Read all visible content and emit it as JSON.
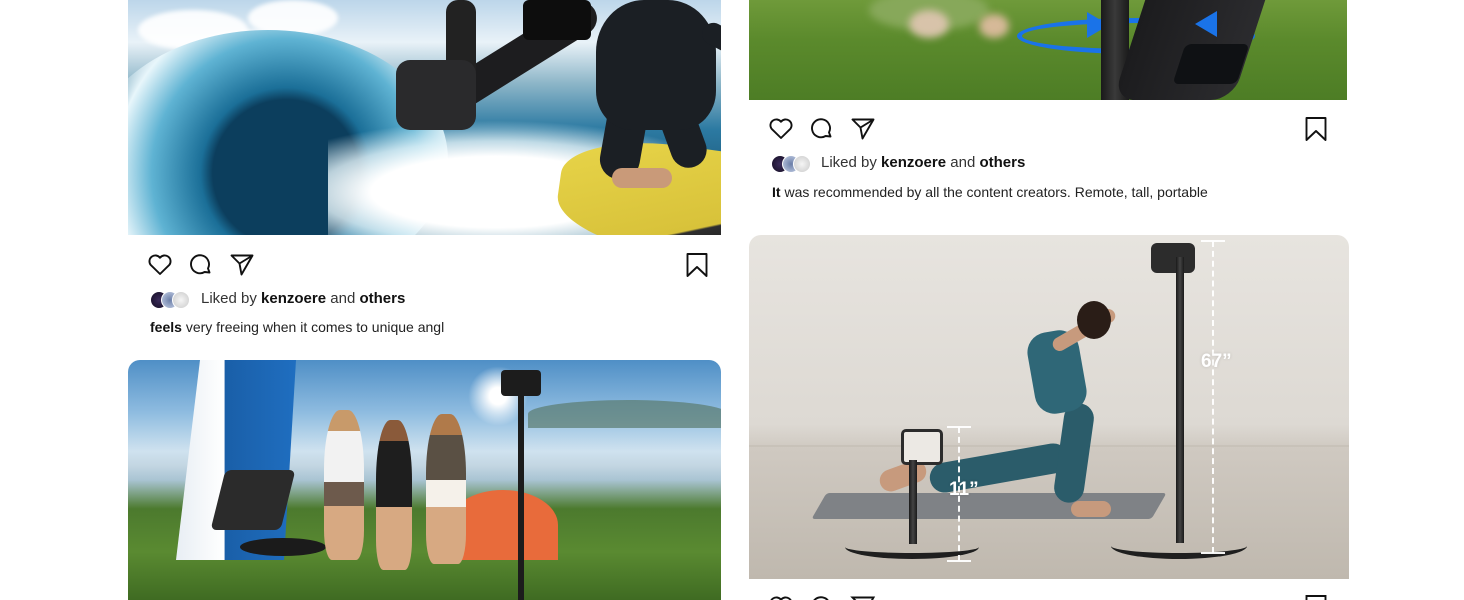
{
  "posts": [
    {
      "id": "surf",
      "liked_prefix": "Liked by",
      "liked_user": "kenzoere",
      "liked_and": "and",
      "liked_others": "others",
      "caption_lead": "feels",
      "caption_rest": "very freeing when it comes to unique angl"
    },
    {
      "id": "grass",
      "liked_prefix": "Liked by",
      "liked_user": "kenzoere",
      "liked_and": "and",
      "liked_others": "others",
      "caption_lead": "It",
      "caption_rest": "was recommended by all the content creators. Remote, tall, portable"
    }
  ],
  "yoga_photo": {
    "tall_height_label": "67”",
    "short_height_label": "11”"
  },
  "icons": [
    "heart-icon",
    "comment-icon",
    "share-icon",
    "bookmark-icon"
  ],
  "colors": {
    "rotation_arrow": "#1a73e8",
    "text": "#111111",
    "background": "#ffffff"
  }
}
